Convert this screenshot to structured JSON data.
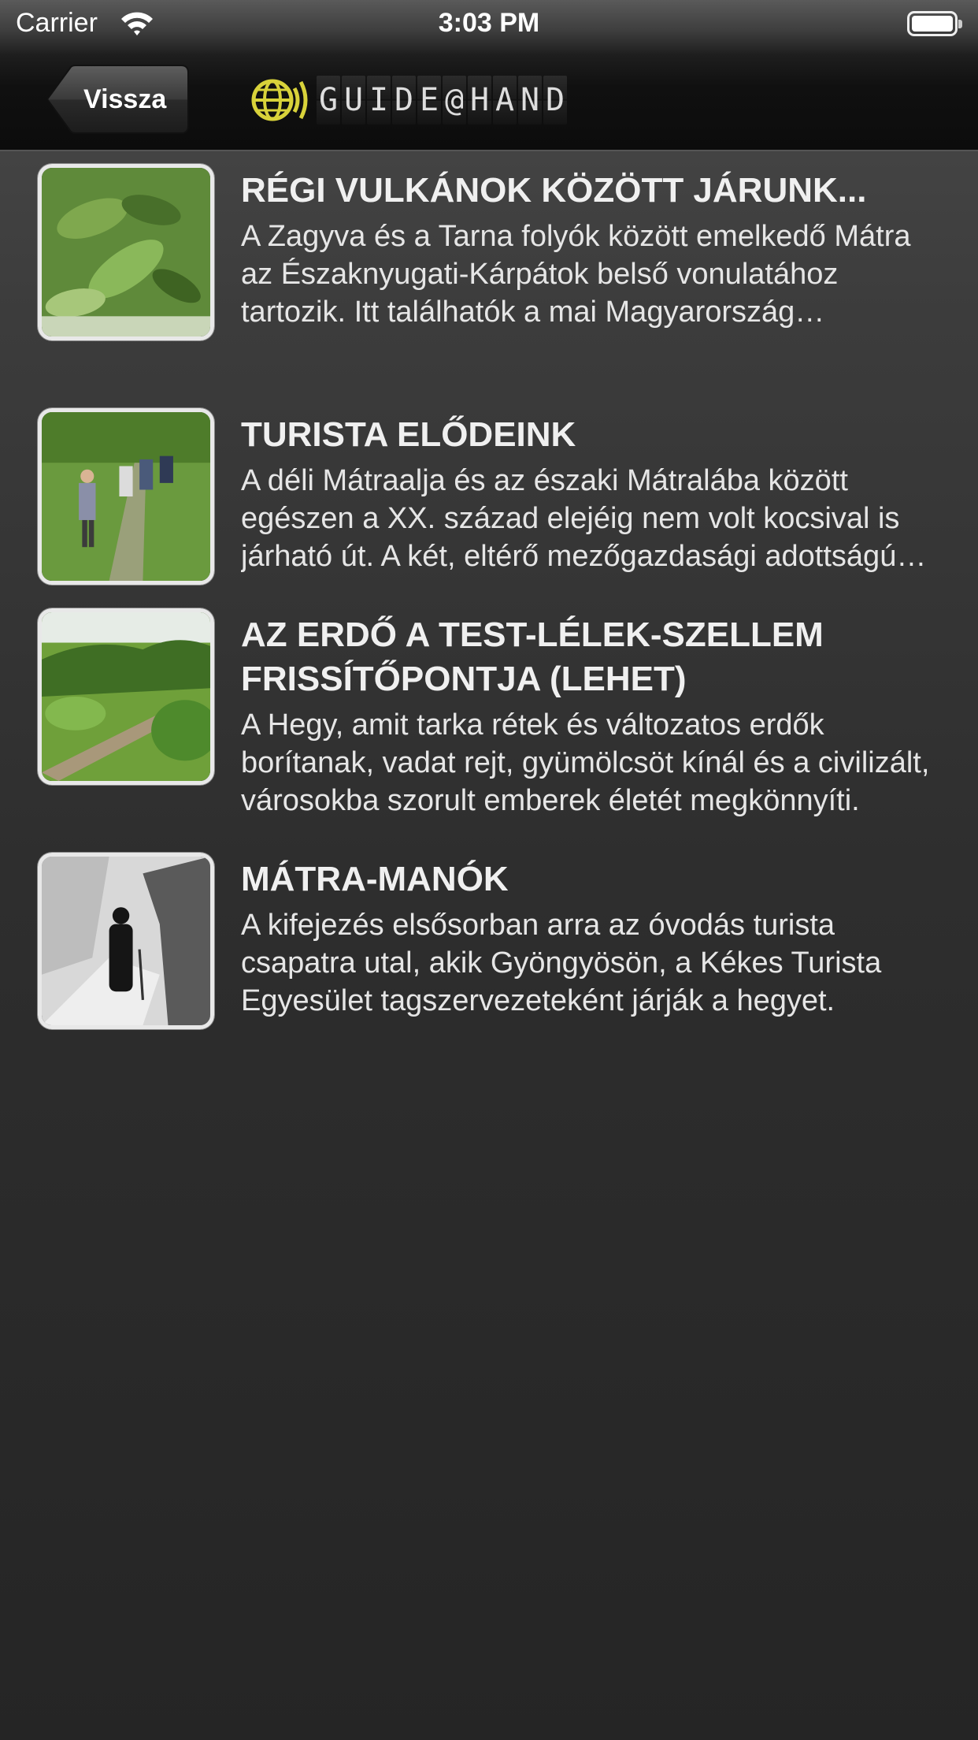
{
  "status_bar": {
    "carrier": "Carrier",
    "time": "3:03 PM"
  },
  "nav": {
    "back_label": "Vissza",
    "brand_letters": [
      "G",
      "U",
      "I",
      "D",
      "E",
      "@",
      "H",
      "A",
      "N",
      "D"
    ]
  },
  "colors": {
    "accent_logo": "#d8d23a",
    "text": "#f0f0f0",
    "background": "#2e2e2e"
  },
  "items": [
    {
      "title": "RÉGI VULKÁNOK KÖZÖTT JÁRUNK...",
      "description": "A Zagyva és a Tarna folyók között emelkedő Mátra az Északnyugati-Kárpátok belső vonulatához tartozik. Itt találhatók a mai Magyarország legmagasabb pontjai.",
      "thumb": "leaves-photo"
    },
    {
      "title": "TURISTA ELŐDEINK",
      "description": "A déli Mátraalja és az északi Mátralába között egészen a XX. század elejéig nem volt kocsival is járható út. A két, eltérő mezőgazdasági adottságú vidék között.",
      "thumb": "hikers-photo"
    },
    {
      "title": "AZ ERDŐ A TEST-LÉLEK-SZELLEM FRISSÍTŐPONTJA (LEHET)",
      "description": "A Hegy, amit tarka rétek és változatos erdők borítanak, vadat rejt, gyümölcsöt kínál és a civilizált, városokba szorult emberek életét megkönnyíti.",
      "thumb": "forest-path-photo"
    },
    {
      "title": "MÁTRA-MANÓK",
      "description": "A kifejezés elsősorban arra az óvodás turista csapatra utal, akik Gyöngyösön, a Kékes Turista Egyesület tagszervezeteként járják a hegyet.",
      "thumb": "winter-walker-photo"
    }
  ]
}
